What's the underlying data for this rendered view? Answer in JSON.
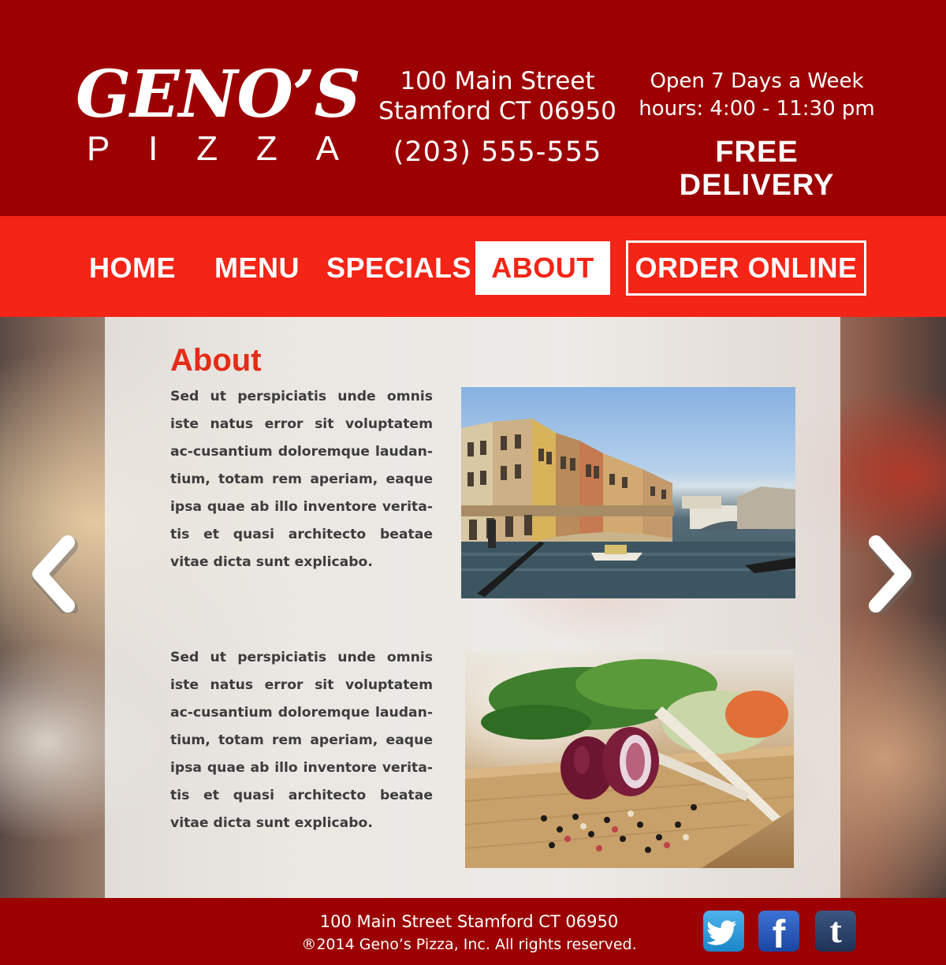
{
  "header": {
    "logo": {
      "name": "GENO’S",
      "sub_letters": [
        "P",
        "I",
        "Z",
        "Z",
        "A"
      ]
    },
    "address_line1": "100 Main Street",
    "address_line2": "Stamford CT 06950",
    "phone": "(203) 555-555",
    "open_days": "Open 7 Days a Week",
    "hours": "hours: 4:00 - 11:30 pm",
    "delivery": "FREE DELIVERY"
  },
  "nav": {
    "home": "HOME",
    "menu": "MENU",
    "specials": "SPECIALS",
    "about": "ABOUT",
    "order": "ORDER ONLINE",
    "active": "about"
  },
  "main": {
    "title": "About",
    "paragraph1": "Sed ut perspiciatis unde omnis iste natus error sit voluptatem ac-cusantium doloremque laudan-tium, totam rem aperiam, eaque ipsa quae ab illo inventore verita-tis et quasi architecto beatae vitae dicta sunt explicabo.",
    "paragraph2": "Sed ut perspiciatis unde omnis iste natus error sit voluptatem ac-cusantium doloremque laudan-tium, totam rem aperiam, eaque ipsa quae ab illo inventore verita-tis et quasi architecto beatae vitae dicta sunt explicabo.",
    "photos": [
      {
        "icon": "venice-canal-photo"
      },
      {
        "icon": "onion-peppercorn-photo"
      }
    ],
    "arrows": {
      "left": "chevron-left-icon",
      "right": "chevron-right-icon"
    }
  },
  "footer": {
    "address": "100 Main Street Stamford CT 06950",
    "copyright": "®2014 Geno’s Pizza, Inc. All rights reserved.",
    "social": [
      {
        "icon": "twitter-icon"
      },
      {
        "icon": "facebook-icon",
        "glyph": "f"
      },
      {
        "icon": "tumblr-icon",
        "glyph": "t"
      }
    ]
  },
  "colors": {
    "header_bg": "#9c0000",
    "nav_bg": "#f42416",
    "accent": "#e42c18",
    "text_dark": "#3c3c3c",
    "white": "#ffffff"
  }
}
